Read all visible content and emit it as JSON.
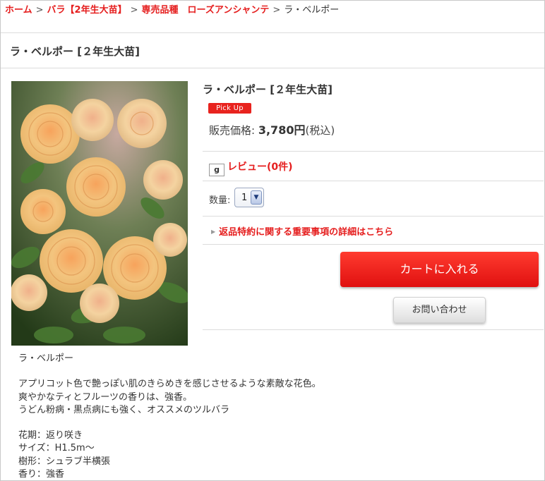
{
  "breadcrumb": {
    "home": "ホーム",
    "category": "バラ【2年生大苗】",
    "subcategory": "専売品種　ローズアンシャンテ",
    "current": "ラ・ベルポー",
    "separator": ">"
  },
  "page": {
    "title": "ラ・ベルポー [２年生大苗]"
  },
  "product": {
    "title": "ラ・ベルポー [２年生大苗]",
    "badge": "Pick Up",
    "price_label": "販売価格:",
    "price_value": "3,780円",
    "price_tax": "(税込)",
    "review_icon": "g",
    "review_link": "レビュー(0件)",
    "quantity_label": "数量:",
    "quantity_value": "1",
    "notice_link": "返品特約に関する重要事項の詳細はこちら",
    "cart_button": "カートに入れる",
    "inquiry_button": "お問い合わせ",
    "image_alt": "rose-photo"
  },
  "description": {
    "name": "ラ・ベルポー",
    "line1": "アプリコット色で艶っぽい肌のきらめきを感じさせるような素敵な花色。",
    "line2": "爽やかなティとフルーツの香りは、強香。",
    "line3": "うどん粉病・黒点病にも強く、オススメのツルバラ",
    "spec1": "花期：返り咲き",
    "spec2": "サイズ：H1.5m～",
    "spec3": "樹形：シュラブ半横張",
    "spec4": "香り：強香"
  },
  "colors": {
    "accent_red": "#e51e1e",
    "cart_red": "#ff2a1f",
    "rose_apricot": "#f2b870",
    "foliage": "#3d5e2a"
  }
}
